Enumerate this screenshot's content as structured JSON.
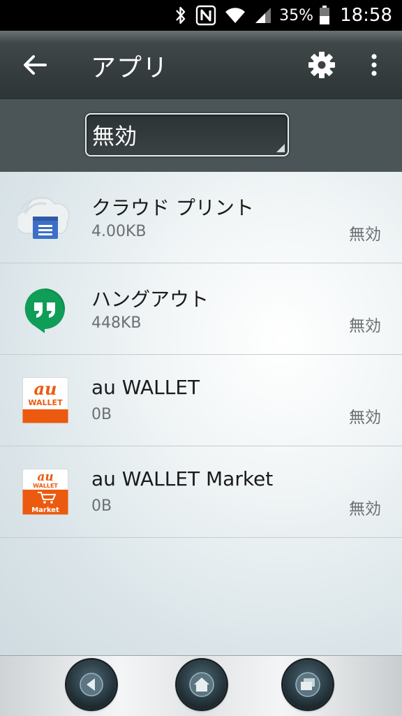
{
  "status_bar": {
    "battery_percent": "35%",
    "time": "18:58",
    "icons": [
      "bluetooth-icon",
      "nfc-icon",
      "wifi-icon",
      "cellular-signal-icon",
      "battery-icon"
    ]
  },
  "action_bar": {
    "title": "アプリ",
    "icons": [
      "back-arrow-icon",
      "gear-icon",
      "more-vert-icon"
    ]
  },
  "filter": {
    "selected": "無効"
  },
  "apps": [
    {
      "name": "クラウド プリント",
      "size": "4.00KB",
      "status": "無効",
      "icon": "cloud-print-icon"
    },
    {
      "name": "ハングアウト",
      "size": "448KB",
      "status": "無効",
      "icon": "hangouts-icon"
    },
    {
      "name": "au WALLET",
      "size": "0B",
      "status": "無効",
      "icon": "au-wallet-icon",
      "icon_text": [
        "au",
        "WALLET"
      ]
    },
    {
      "name": "au WALLET Market",
      "size": "0B",
      "status": "無効",
      "icon": "au-wallet-market-icon",
      "icon_text": [
        "au",
        "WALLET",
        "Market"
      ]
    }
  ],
  "nav_bar": {
    "icons": [
      "nav-back-icon",
      "nav-home-icon",
      "nav-recents-icon"
    ]
  },
  "colors": {
    "au_orange": "#eb5a0f",
    "hangouts_green": "#0f9d58",
    "cloud_print_blue": "#4a7fd6"
  }
}
